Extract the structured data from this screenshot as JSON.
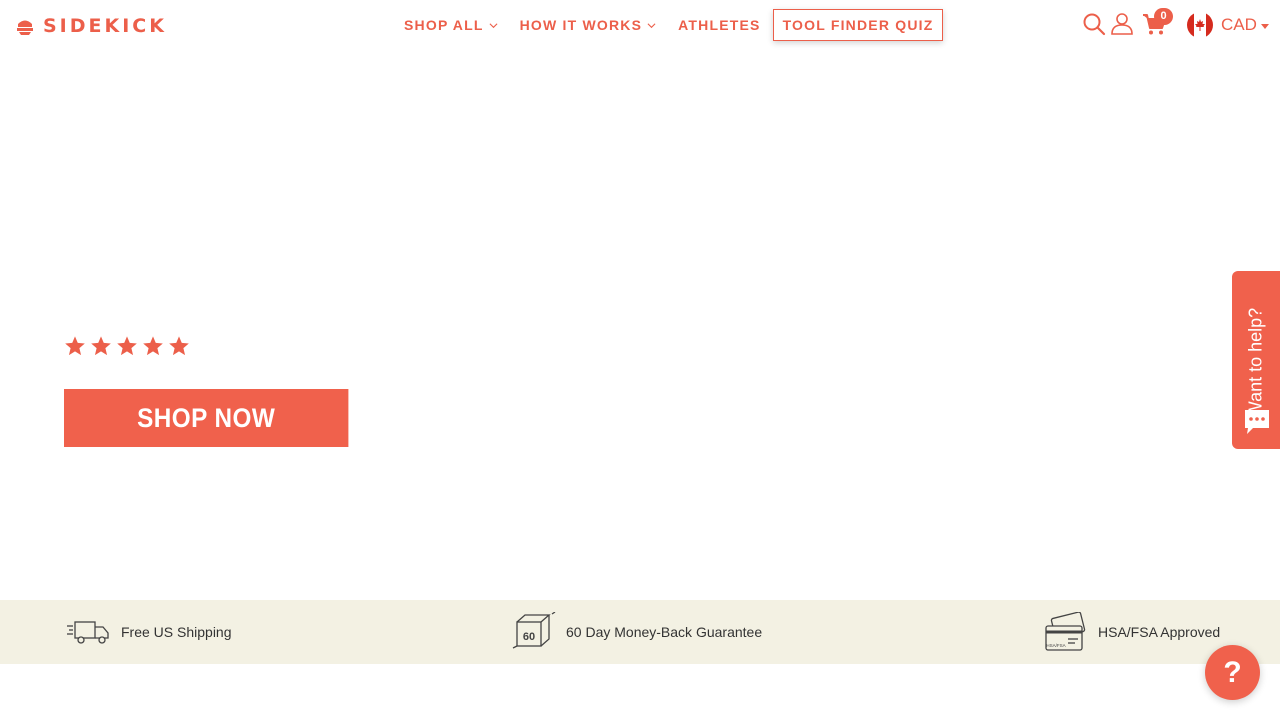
{
  "brand": {
    "name": "SIDEKICK",
    "accent": "#ec5f4a",
    "button": "#f0614c",
    "band_bg": "#f3f1e3"
  },
  "nav": {
    "items": [
      {
        "label": "SHOP ALL",
        "has_dropdown": true
      },
      {
        "label": "HOW IT WORKS",
        "has_dropdown": true
      },
      {
        "label": "ATHLETES",
        "has_dropdown": false
      },
      {
        "label": "TOOL FINDER QUIZ",
        "has_dropdown": false
      }
    ]
  },
  "header_actions": {
    "icons": [
      "search-icon",
      "user-icon",
      "cart-icon"
    ],
    "cart_count": "0",
    "currency": "CAD",
    "flag": "canada-flag"
  },
  "hero": {
    "rating_stars": 5,
    "cta_label": "SHOP NOW"
  },
  "help_tab": {
    "label": "Want to help?"
  },
  "benefits": [
    {
      "icon": "truck-icon",
      "label": "Free US Shipping"
    },
    {
      "icon": "60-day-icon",
      "label": "60 Day Money-Back Guarantee",
      "icon_text": "60"
    },
    {
      "icon": "hsa-card-icon",
      "label": "HSA/FSA Approved",
      "icon_text": "HSA/FSA"
    }
  ],
  "help_bubble": {
    "label": "?"
  }
}
